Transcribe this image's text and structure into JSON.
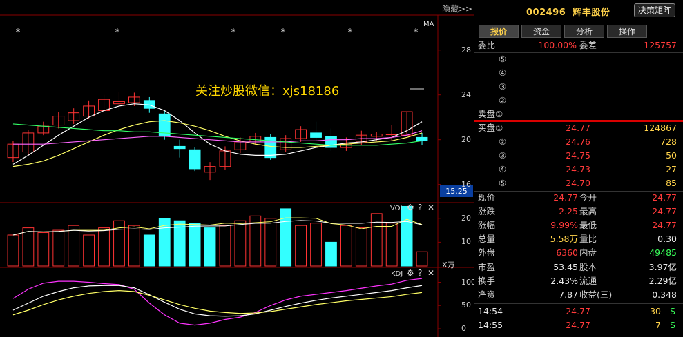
{
  "header": {
    "code": "002496",
    "name": "辉丰股份",
    "matrix_button": "决策矩阵",
    "hide_label": "隐藏>>"
  },
  "tabs": [
    {
      "label": "报价"
    },
    {
      "label": "资金"
    },
    {
      "label": "分析"
    },
    {
      "label": "操作"
    }
  ],
  "ratio": {
    "label": "委比",
    "value": "100.00%",
    "diff_label": "委差",
    "diff_value": "125757"
  },
  "sell_levels": [
    "⑤",
    "④",
    "③",
    "②",
    "卖盘①"
  ],
  "buy_levels": [
    {
      "label": "买盘①",
      "price": "24.77",
      "volume": "124867"
    },
    {
      "label": "②",
      "price": "24.76",
      "volume": "728"
    },
    {
      "label": "③",
      "price": "24.75",
      "volume": "50"
    },
    {
      "label": "④",
      "price": "24.73",
      "volume": "27"
    },
    {
      "label": "⑤",
      "price": "24.70",
      "volume": "85"
    }
  ],
  "stats": [
    {
      "l1": "现价",
      "v1": "24.77",
      "l2": "今开",
      "v2": "24.77"
    },
    {
      "l1": "涨跌",
      "v1": "2.25",
      "l2": "最高",
      "v2": "24.77"
    },
    {
      "l1": "涨幅",
      "v1": "9.99%",
      "l2": "最低",
      "v2": "24.77"
    },
    {
      "l1": "总量",
      "v1": "5.58万",
      "l2": "量比",
      "v2": "0.30"
    },
    {
      "l1": "外盘",
      "v1": "6360",
      "l2": "内盘",
      "v2": "49485"
    }
  ],
  "fundamentals": [
    {
      "l1": "市盈",
      "v1": "53.45",
      "l2": "股本",
      "v2": "3.97亿"
    },
    {
      "l1": "换手",
      "v1": "2.43%",
      "l2": "流通",
      "v2": "2.29亿"
    },
    {
      "l1": "净资",
      "v1": "7.87",
      "l2": "收益(三)",
      "v2": "0.348"
    }
  ],
  "ticks": [
    {
      "time": "14:54",
      "price": "24.77",
      "vol": "30",
      "side": "S"
    },
    {
      "time": "14:55",
      "price": "24.77",
      "vol": "7",
      "side": "S"
    }
  ],
  "watermark": "关注炒股微信：xjs18186",
  "current_price_tag": "15.25",
  "chart_data": [
    {
      "type": "candlestick",
      "title": "",
      "y_ticks": [
        28,
        24,
        20,
        16
      ],
      "ylim": [
        14.5,
        31
      ],
      "ma_label": "MA",
      "candles": [
        {
          "o": 18.4,
          "c": 19.6,
          "h": 19.9,
          "l": 18.0
        },
        {
          "o": 18.9,
          "c": 20.6,
          "h": 20.9,
          "l": 18.6
        },
        {
          "o": 20.6,
          "c": 21.2,
          "h": 21.6,
          "l": 20.4
        },
        {
          "o": 21.3,
          "c": 22.1,
          "h": 22.5,
          "l": 21.0
        },
        {
          "o": 21.7,
          "c": 22.4,
          "h": 22.8,
          "l": 21.4
        },
        {
          "o": 22.1,
          "c": 23.0,
          "h": 23.5,
          "l": 21.9
        },
        {
          "o": 22.6,
          "c": 23.6,
          "h": 24.0,
          "l": 22.4
        },
        {
          "o": 23.2,
          "c": 23.4,
          "h": 24.3,
          "l": 22.6
        },
        {
          "o": 23.3,
          "c": 23.8,
          "h": 24.2,
          "l": 23.0
        },
        {
          "o": 23.5,
          "c": 22.8,
          "h": 23.8,
          "l": 22.4
        },
        {
          "o": 22.3,
          "c": 20.3,
          "h": 22.6,
          "l": 20.0
        },
        {
          "o": 19.4,
          "c": 19.2,
          "h": 20.0,
          "l": 18.4
        },
        {
          "o": 19.1,
          "c": 17.4,
          "h": 19.3,
          "l": 17.2
        },
        {
          "o": 17.1,
          "c": 17.6,
          "h": 18.0,
          "l": 16.4
        },
        {
          "o": 17.6,
          "c": 19.0,
          "h": 19.4,
          "l": 17.3
        },
        {
          "o": 19.1,
          "c": 19.8,
          "h": 20.2,
          "l": 18.8
        },
        {
          "o": 19.8,
          "c": 20.3,
          "h": 20.6,
          "l": 19.5
        },
        {
          "o": 20.2,
          "c": 18.4,
          "h": 20.5,
          "l": 18.2
        },
        {
          "o": 19.1,
          "c": 20.1,
          "h": 20.4,
          "l": 18.9
        },
        {
          "o": 20.1,
          "c": 20.9,
          "h": 21.2,
          "l": 19.8
        },
        {
          "o": 20.6,
          "c": 20.2,
          "h": 21.6,
          "l": 19.9
        },
        {
          "o": 20.3,
          "c": 19.3,
          "h": 21.0,
          "l": 19.0
        },
        {
          "o": 19.3,
          "c": 19.6,
          "h": 20.2,
          "l": 19.0
        },
        {
          "o": 19.8,
          "c": 20.4,
          "h": 20.8,
          "l": 19.5
        },
        {
          "o": 20.3,
          "c": 20.5,
          "h": 20.7,
          "l": 19.9
        },
        {
          "o": 20.5,
          "c": 20.5,
          "h": 21.3,
          "l": 19.9
        },
        {
          "o": 20.4,
          "c": 22.5,
          "h": 22.5,
          "l": 20.4
        },
        {
          "o": 20.2,
          "c": 19.9,
          "h": 20.6,
          "l": 19.5
        }
      ],
      "series": [
        {
          "color": "#ffffff",
          "values": [
            17.8,
            18.6,
            19.5,
            20.4,
            21.2,
            22.0,
            22.6,
            23.0,
            23.2,
            23.1,
            22.6,
            21.7,
            20.6,
            19.6,
            19.0,
            18.7,
            18.6,
            18.6,
            18.7,
            19.0,
            19.3,
            19.5,
            19.7,
            19.8,
            20.0,
            20.2,
            20.8,
            21.6
          ]
        },
        {
          "color": "#ffff66",
          "values": [
            17.6,
            17.8,
            18.1,
            18.6,
            19.2,
            19.8,
            20.4,
            20.9,
            21.3,
            21.6,
            21.7,
            21.5,
            21.2,
            20.8,
            20.3,
            19.9,
            19.6,
            19.4,
            19.3,
            19.3,
            19.4,
            19.5,
            19.6,
            19.7,
            19.8,
            19.9,
            20.2,
            20.6
          ]
        },
        {
          "color": "#ff66ff",
          "values": [
            19.6,
            19.6,
            19.6,
            19.7,
            19.8,
            19.9,
            20.0,
            20.1,
            20.2,
            20.3,
            20.3,
            20.2,
            20.1,
            20.0,
            19.9,
            19.8,
            19.8,
            19.8,
            19.8,
            19.9,
            19.9,
            20.0,
            20.0,
            20.1,
            20.1,
            20.2,
            20.4,
            20.8
          ]
        },
        {
          "color": "#33ff66",
          "values": [
            21.4,
            21.3,
            21.2,
            21.1,
            21.0,
            20.9,
            20.8,
            20.8,
            20.7,
            20.7,
            20.6,
            20.5,
            20.4,
            20.3,
            20.2,
            20.1,
            20.0,
            19.9,
            19.8,
            19.7,
            19.6,
            19.5,
            19.5,
            19.5,
            19.5,
            19.6,
            19.7,
            19.9
          ]
        }
      ]
    },
    {
      "type": "bar",
      "title": "VOL",
      "y_ticks": [
        20,
        10
      ],
      "unit": "X万",
      "ylim": [
        0,
        26
      ],
      "values": [
        13,
        16,
        14,
        15,
        17,
        13,
        16,
        19,
        17,
        13,
        20,
        19,
        18,
        16,
        17,
        19,
        21,
        20,
        24,
        17,
        18,
        10,
        17,
        16,
        22,
        18,
        25,
        6
      ],
      "down": [
        false,
        false,
        false,
        false,
        false,
        false,
        false,
        false,
        false,
        true,
        true,
        true,
        true,
        true,
        false,
        false,
        false,
        false,
        true,
        false,
        false,
        true,
        false,
        false,
        false,
        false,
        true,
        false
      ]
    },
    {
      "type": "line",
      "title": "KDJ",
      "y_ticks": [
        100,
        50,
        0
      ],
      "ylim": [
        0,
        120
      ],
      "series": [
        {
          "color": "#ff33ff",
          "values": [
            65,
            85,
            98,
            102,
            102,
            100,
            97,
            95,
            85,
            55,
            30,
            12,
            8,
            12,
            20,
            25,
            35,
            50,
            62,
            70,
            74,
            78,
            82,
            87,
            92,
            96,
            104,
            108
          ]
        },
        {
          "color": "#ffffff",
          "values": [
            40,
            55,
            70,
            80,
            88,
            92,
            93,
            93,
            88,
            73,
            57,
            42,
            32,
            28,
            27,
            28,
            32,
            40,
            48,
            55,
            61,
            66,
            70,
            74,
            78,
            82,
            88,
            93
          ]
        },
        {
          "color": "#ffff66",
          "values": [
            30,
            40,
            52,
            62,
            70,
            76,
            80,
            82,
            80,
            72,
            62,
            52,
            44,
            38,
            35,
            33,
            34,
            37,
            42,
            47,
            52,
            56,
            60,
            63,
            66,
            69,
            74,
            78
          ]
        }
      ]
    }
  ]
}
